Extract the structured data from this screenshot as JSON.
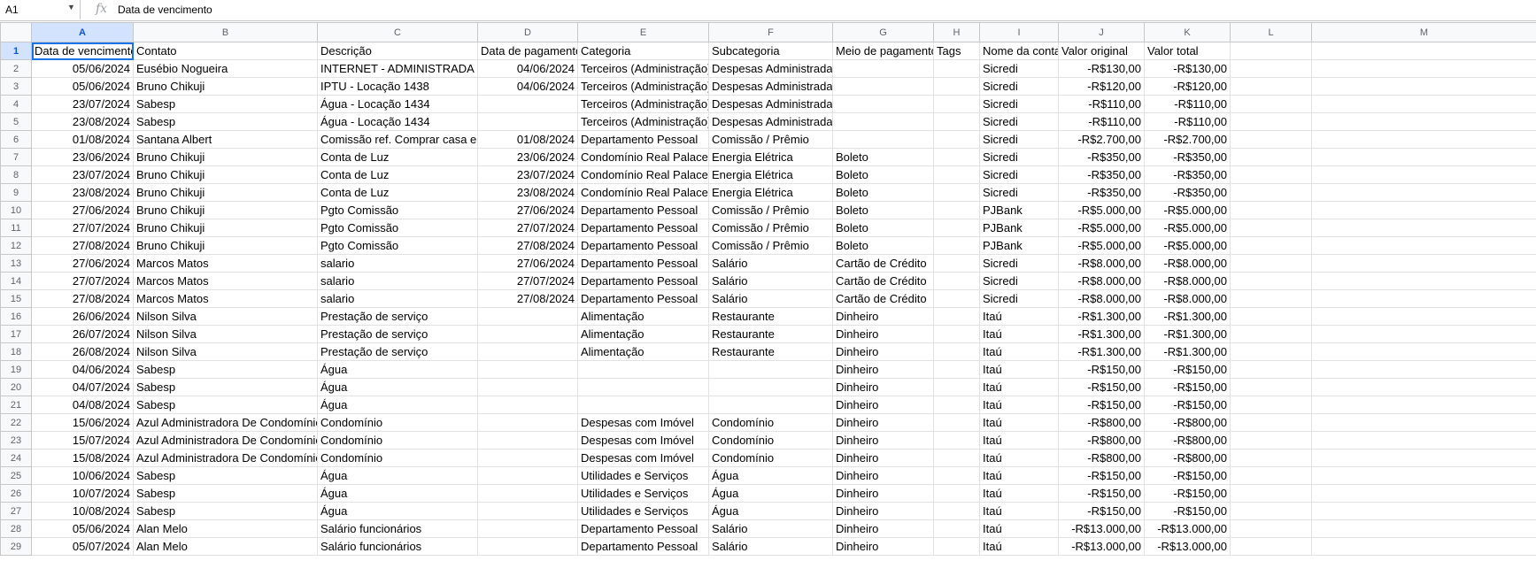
{
  "formula_bar": {
    "cell_ref": "A1",
    "fx_icon": "fx",
    "content": "Data de vencimento"
  },
  "columns": [
    "A",
    "B",
    "C",
    "D",
    "E",
    "F",
    "G",
    "H",
    "I",
    "J",
    "K",
    "L",
    "M"
  ],
  "rows": [
    [
      "Data de vencimento",
      "Contato",
      "Descrição",
      "Data de pagamento",
      "Categoria",
      "Subcategoria",
      "Meio de pagamento",
      "Tags",
      "Nome da conta",
      "Valor original",
      "Valor total",
      "",
      ""
    ],
    [
      "05/06/2024",
      "Eusébio Nogueira",
      "INTERNET - ADMINISTRADA - L",
      "04/06/2024",
      "Terceiros (Administração)",
      "Despesas Administradas",
      "",
      "",
      "Sicredi",
      "-R$130,00",
      "-R$130,00",
      "",
      ""
    ],
    [
      "05/06/2024",
      "Bruno Chikuji",
      "IPTU - Locação 1438",
      "04/06/2024",
      "Terceiros (Administração)",
      "Despesas Administradas",
      "",
      "",
      "Sicredi",
      "-R$120,00",
      "-R$120,00",
      "",
      ""
    ],
    [
      "23/07/2024",
      "Sabesp",
      "Água - Locação 1434",
      "",
      "Terceiros (Administração)",
      "Despesas Administradas",
      "",
      "",
      "Sicredi",
      "-R$110,00",
      "-R$110,00",
      "",
      ""
    ],
    [
      "23/08/2024",
      "Sabesp",
      "Água - Locação 1434",
      "",
      "Terceiros (Administração)",
      "Despesas Administradas",
      "",
      "",
      "Sicredi",
      "-R$110,00",
      "-R$110,00",
      "",
      ""
    ],
    [
      "01/08/2024",
      "Santana Albert",
      "Comissão ref. Comprar casa em",
      "01/08/2024",
      "Departamento Pessoal",
      "Comissão / Prêmio",
      "",
      "",
      "Sicredi",
      "-R$2.700,00",
      "-R$2.700,00",
      "",
      ""
    ],
    [
      "23/06/2024",
      "Bruno Chikuji",
      "Conta de Luz",
      "23/06/2024",
      "Condomínio Real Palace",
      "Energia Elétrica",
      "Boleto",
      "",
      "Sicredi",
      "-R$350,00",
      "-R$350,00",
      "",
      ""
    ],
    [
      "23/07/2024",
      "Bruno Chikuji",
      "Conta de Luz",
      "23/07/2024",
      "Condomínio Real Palace",
      "Energia Elétrica",
      "Boleto",
      "",
      "Sicredi",
      "-R$350,00",
      "-R$350,00",
      "",
      ""
    ],
    [
      "23/08/2024",
      "Bruno Chikuji",
      "Conta de Luz",
      "23/08/2024",
      "Condomínio Real Palace",
      "Energia Elétrica",
      "Boleto",
      "",
      "Sicredi",
      "-R$350,00",
      "-R$350,00",
      "",
      ""
    ],
    [
      "27/06/2024",
      "Bruno Chikuji",
      "Pgto Comissão",
      "27/06/2024",
      "Departamento Pessoal",
      "Comissão / Prêmio",
      "Boleto",
      "",
      "PJBank",
      "-R$5.000,00",
      "-R$5.000,00",
      "",
      ""
    ],
    [
      "27/07/2024",
      "Bruno Chikuji",
      "Pgto Comissão",
      "27/07/2024",
      "Departamento Pessoal",
      "Comissão / Prêmio",
      "Boleto",
      "",
      "PJBank",
      "-R$5.000,00",
      "-R$5.000,00",
      "",
      ""
    ],
    [
      "27/08/2024",
      "Bruno Chikuji",
      "Pgto Comissão",
      "27/08/2024",
      "Departamento Pessoal",
      "Comissão / Prêmio",
      "Boleto",
      "",
      "PJBank",
      "-R$5.000,00",
      "-R$5.000,00",
      "",
      ""
    ],
    [
      "27/06/2024",
      "Marcos Matos",
      "salario",
      "27/06/2024",
      "Departamento Pessoal",
      "Salário",
      "Cartão de Crédito",
      "",
      "Sicredi",
      "-R$8.000,00",
      "-R$8.000,00",
      "",
      ""
    ],
    [
      "27/07/2024",
      "Marcos Matos",
      "salario",
      "27/07/2024",
      "Departamento Pessoal",
      "Salário",
      "Cartão de Crédito",
      "",
      "Sicredi",
      "-R$8.000,00",
      "-R$8.000,00",
      "",
      ""
    ],
    [
      "27/08/2024",
      "Marcos Matos",
      "salario",
      "27/08/2024",
      "Departamento Pessoal",
      "Salário",
      "Cartão de Crédito",
      "",
      "Sicredi",
      "-R$8.000,00",
      "-R$8.000,00",
      "",
      ""
    ],
    [
      "26/06/2024",
      "Nilson Silva",
      "Prestação de serviço",
      "",
      "Alimentação",
      "Restaurante",
      "Dinheiro",
      "",
      "Itaú",
      "-R$1.300,00",
      "-R$1.300,00",
      "",
      ""
    ],
    [
      "26/07/2024",
      "Nilson Silva",
      "Prestação de serviço",
      "",
      "Alimentação",
      "Restaurante",
      "Dinheiro",
      "",
      "Itaú",
      "-R$1.300,00",
      "-R$1.300,00",
      "",
      ""
    ],
    [
      "26/08/2024",
      "Nilson Silva",
      "Prestação de serviço",
      "",
      "Alimentação",
      "Restaurante",
      "Dinheiro",
      "",
      "Itaú",
      "-R$1.300,00",
      "-R$1.300,00",
      "",
      ""
    ],
    [
      "04/06/2024",
      "Sabesp",
      "Água",
      "",
      "",
      "",
      "Dinheiro",
      "",
      "Itaú",
      "-R$150,00",
      "-R$150,00",
      "",
      ""
    ],
    [
      "04/07/2024",
      "Sabesp",
      "Água",
      "",
      "",
      "",
      "Dinheiro",
      "",
      "Itaú",
      "-R$150,00",
      "-R$150,00",
      "",
      ""
    ],
    [
      "04/08/2024",
      "Sabesp",
      "Água",
      "",
      "",
      "",
      "Dinheiro",
      "",
      "Itaú",
      "-R$150,00",
      "-R$150,00",
      "",
      ""
    ],
    [
      "15/06/2024",
      "Azul Administradora De Condomínios",
      "Condomínio",
      "",
      "Despesas com Imóvel",
      "Condomínio",
      "Dinheiro",
      "",
      "Itaú",
      "-R$800,00",
      "-R$800,00",
      "",
      ""
    ],
    [
      "15/07/2024",
      "Azul Administradora De Condomínios",
      "Condomínio",
      "",
      "Despesas com Imóvel",
      "Condomínio",
      "Dinheiro",
      "",
      "Itaú",
      "-R$800,00",
      "-R$800,00",
      "",
      ""
    ],
    [
      "15/08/2024",
      "Azul Administradora De Condomínios",
      "Condomínio",
      "",
      "Despesas com Imóvel",
      "Condomínio",
      "Dinheiro",
      "",
      "Itaú",
      "-R$800,00",
      "-R$800,00",
      "",
      ""
    ],
    [
      "10/06/2024",
      "Sabesp",
      "Água",
      "",
      "Utilidades e Serviços",
      "Água",
      "Dinheiro",
      "",
      "Itaú",
      "-R$150,00",
      "-R$150,00",
      "",
      ""
    ],
    [
      "10/07/2024",
      "Sabesp",
      "Água",
      "",
      "Utilidades e Serviços",
      "Água",
      "Dinheiro",
      "",
      "Itaú",
      "-R$150,00",
      "-R$150,00",
      "",
      ""
    ],
    [
      "10/08/2024",
      "Sabesp",
      "Água",
      "",
      "Utilidades e Serviços",
      "Água",
      "Dinheiro",
      "",
      "Itaú",
      "-R$150,00",
      "-R$150,00",
      "",
      ""
    ],
    [
      "05/06/2024",
      "Alan Melo",
      "Salário funcionários",
      "",
      "Departamento Pessoal",
      "Salário",
      "Dinheiro",
      "",
      "Itaú",
      "-R$13.000,00",
      "-R$13.000,00",
      "",
      ""
    ],
    [
      "05/07/2024",
      "Alan Melo",
      "Salário funcionários",
      "",
      "Departamento Pessoal",
      "Salário",
      "Dinheiro",
      "",
      "Itaú",
      "-R$13.000,00",
      "-R$13.000,00",
      "",
      ""
    ]
  ]
}
